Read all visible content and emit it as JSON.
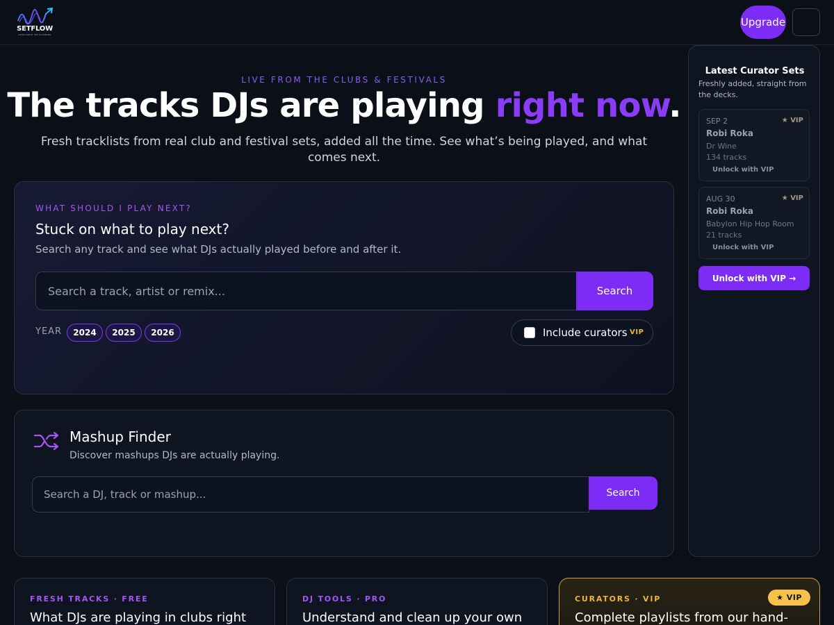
{
  "header": {
    "logo_text": "SETFLOW",
    "logo_tagline": "INTELLIGENT SET PLANNING",
    "upgrade_label": "Upgrade"
  },
  "hero": {
    "eyebrow": "LIVE FROM THE CLUBS & FESTIVALS",
    "title_main": "The tracks DJs are playing ",
    "title_accent": "right now",
    "title_end": ".",
    "subtitle": "Fresh tracklists from real club and festival sets, added all the time. See what’s being played, and what comes next."
  },
  "next_track": {
    "eyebrow": "WHAT SHOULD I PLAY NEXT?",
    "title": "Stuck on what to play next?",
    "description": "Search any track and see what DJs actually played before and after it.",
    "search_placeholder": "Search a track, artist or remix...",
    "search_button": "Search",
    "year_label": "YEAR",
    "years": [
      "2024",
      "2025",
      "2026"
    ],
    "curators_label": "Include curators",
    "curators_badge": "VIP"
  },
  "mashup": {
    "title": "Mashup Finder",
    "description": "Discover mashups DJs are actually playing.",
    "search_placeholder": "Search a DJ, track or mashup...",
    "search_button": "Search"
  },
  "sidebar": {
    "title": "Latest Curator Sets",
    "subtitle": "Freshly added, straight from the decks.",
    "sets": [
      {
        "date": "SEP 2",
        "badge": "★ VIP",
        "dj": "Robi Roka",
        "venue": "Dr Wine",
        "tracks": "134 tracks",
        "unlock": "Unlock with VIP"
      },
      {
        "date": "AUG 30",
        "badge": "★ VIP",
        "dj": "Robi Roka",
        "venue": "Babylon Hip Hop Room",
        "tracks": "21 tracks",
        "unlock": "Unlock with VIP"
      }
    ],
    "unlock_button": "Unlock with VIP →"
  },
  "features": [
    {
      "eyebrow": "FRESH TRACKS · FREE",
      "title": "What DJs are playing in clubs right",
      "eyebrow_color": "#a855f7"
    },
    {
      "eyebrow": "DJ TOOLS · PRO",
      "title": "Understand and clean up your own",
      "eyebrow_color": "#a855f7"
    },
    {
      "eyebrow": "CURATORS · VIP",
      "title": "Complete playlists from our hand-",
      "eyebrow_color": "#f2b33d",
      "badge": "★ VIP"
    }
  ],
  "colors": {
    "accent": "#7c2cf5",
    "accent_text": "#8b3cf7",
    "vip_gold": "#f5c24b",
    "background": "#0b0f17"
  }
}
